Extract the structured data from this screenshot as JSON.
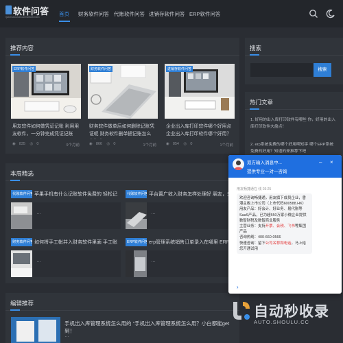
{
  "site": {
    "logo_title": "软件问答",
    "logo_sub": "rjwd.huilourule.com/article/index"
  },
  "nav": [
    "首页",
    "财务软件问答",
    "代账软件问答",
    "进销存软件问答",
    "ERP软件问答"
  ],
  "featured": {
    "title": "推荐内容",
    "cards": [
      {
        "tag": "ERP软件问答",
        "title": "用友软件如何做凭证记账 利用用友软件，一分钟完成凭证记账",
        "views": "835",
        "likes": "0",
        "date": "9个月前"
      },
      {
        "tag": "财务软件问答",
        "title": "财务软件做单后如何删除记账凭证呢 财务软件删单据记账怎么办？实",
        "views": "866",
        "likes": "0",
        "date": "1个月前"
      },
      {
        "tag": "进销存软件问答",
        "title": "企业出入库打印软件哪个好用点 企业出入库打印软件哪个好用？",
        "views": "854",
        "likes": "0",
        "date": "1个月前"
      }
    ]
  },
  "weekly": {
    "title": "本周精选",
    "items": [
      {
        "tag": "代账软件问答",
        "title": "苹果手机有什么记账软件免费的 轻松记…",
        "more": "…"
      },
      {
        "tag": "代账软件问答",
        "title": "平台置广收入财务怎样处理好 朋友，来…",
        "more": "…"
      },
      {
        "tag": "财务软件问答",
        "title": "如何将手工帐并入财务软件里面 手工账…",
        "more": "…"
      },
      {
        "tag": "ERP软件问答",
        "title": "erp管理系统销售订单录入在哪里 ERP管…",
        "more": "…"
      }
    ]
  },
  "editor": {
    "title": "编辑推荐",
    "item_title": "手机出入库管理系统怎么用的 \"手机出入库管理系统怎么用？小白都能get到！",
    "more": "…"
  },
  "sidebar": {
    "search_title": "搜索",
    "search_placeholder": "",
    "search_button": "搜索",
    "hot_title": "热门文章",
    "hot_items": [
      {
        "num": "1.",
        "text": "好用的出入库打印软件有哪些 你，好用的出入库打印软件大盘点！"
      },
      {
        "num": "2.",
        "text": "erp系统免费的哪个好用啊知乎 哪个ERP系统免费的好用？知道的来推荐下吧"
      }
    ]
  },
  "chat": {
    "name": "双方输入消息中...",
    "subtitle": "提供专业一对一咨询",
    "time": "用友畅捷通在 线 03:25",
    "msg_1": "欢迎咨询畅捷通，用友旗下成员企业，香港主板上市公司（上市代码600588.HK）",
    "msg_2": "用友产品：好会计、好业务、易代账等SaaS产品，已为超550万家小微企业提供数智财税及数智商业服务",
    "msg_3": "主营业务：支持",
    "hl_1": "开票、会税、飞书",
    "msg_4": "等集团产品",
    "msg_5": "咨询热线：400-660-0566",
    "msg_6": "快速咨询：留下",
    "hl_2": "公司名称和电话",
    "msg_7": "，马上给您开通试用",
    "more": "›"
  },
  "watermark": {
    "text": "自动秒收录",
    "sub": "AUTO.SHOULU.CC"
  },
  "colors": {
    "accent": "#3a8fe8",
    "bg": "#2a2d33",
    "panel": "#30343a",
    "chat_head": "#1f6fe0"
  }
}
